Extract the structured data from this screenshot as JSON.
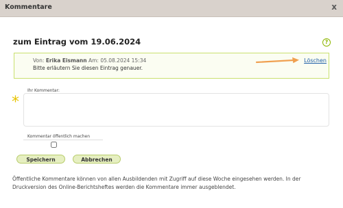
{
  "dialog": {
    "title": "Kommentare",
    "close_label": "x"
  },
  "entry": {
    "heading": "zum Eintrag vom 19.06.2024",
    "help_label": "?"
  },
  "comment": {
    "from_label": "Von:",
    "author": "Erika Eismann",
    "date_label": "Am:",
    "date": "05.08.2024 15:34",
    "text": "Bitte erläutern Sie diesen Eintrag genauer.",
    "delete_label": "Löschen"
  },
  "form": {
    "comment_label": "Ihr Kommentar:",
    "comment_value": "",
    "required_marker": "*",
    "public_label": "Kommentar öffentlich machen",
    "public_checked": false
  },
  "buttons": {
    "save_label": "Speichern",
    "cancel_label": "Abbrechen"
  },
  "info_text": "Öffentliche Kommentare können von allen Ausbildenden mit Zugriff auf diese Woche eingesehen werden. In der Druckversion des Online-Berichtsheftes werden die Kommentare immer ausgeblendet.",
  "colors": {
    "titlebar": "#d9d2cc",
    "accent_green": "#b7cc6a",
    "arrow_orange": "#f0a050",
    "required_yellow": "#e8c300",
    "link_blue": "#1f5fa8"
  },
  "icons": {
    "help": "help-icon",
    "close": "close-icon",
    "arrow": "arrow-icon"
  }
}
